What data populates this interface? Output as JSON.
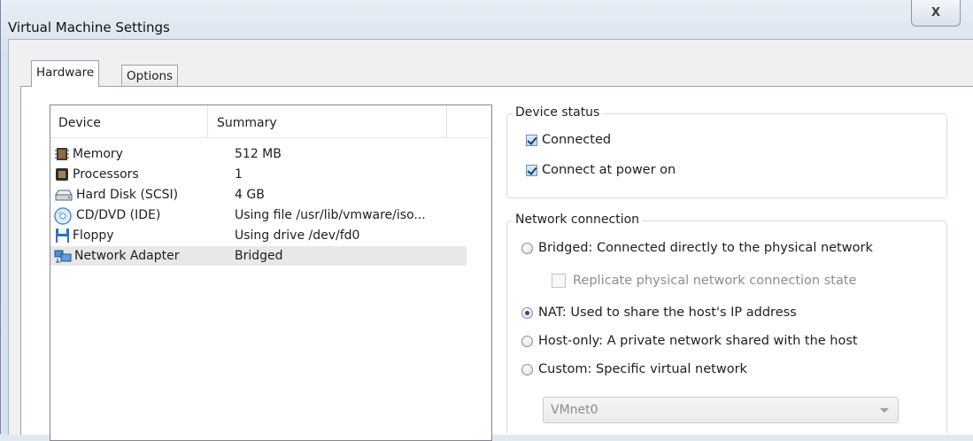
{
  "window": {
    "title": "Virtual Machine Settings",
    "close_glyph": "X"
  },
  "tabs": [
    {
      "label": "Hardware",
      "active": true
    },
    {
      "label": "Options",
      "active": false
    }
  ],
  "device_list": {
    "columns": [
      "Device",
      "Summary"
    ],
    "rows": [
      {
        "icon": "memory-icon",
        "device": "Memory",
        "summary": "512 MB"
      },
      {
        "icon": "processor-icon",
        "device": "Processors",
        "summary": "1"
      },
      {
        "icon": "hard-disk-icon",
        "device": "Hard Disk (SCSI)",
        "summary": "4 GB"
      },
      {
        "icon": "cd-dvd-icon",
        "device": "CD/DVD (IDE)",
        "summary": "Using file /usr/lib/vmware/iso..."
      },
      {
        "icon": "floppy-icon",
        "device": "Floppy",
        "summary": "Using drive /dev/fd0"
      },
      {
        "icon": "network-adapter-icon",
        "device": "Network Adapter",
        "summary": "Bridged"
      }
    ],
    "selected_index": 5
  },
  "device_status": {
    "legend": "Device status",
    "connected_label": "Connected",
    "connected_checked": true,
    "connect_power_label": "Connect at power on",
    "connect_power_checked": true
  },
  "network_connection": {
    "legend": "Network connection",
    "bridged_label": "Bridged: Connected directly to the physical network",
    "replicate_label": "Replicate physical network connection state",
    "nat_label": "NAT: Used to share the host's IP address",
    "host_only_label": "Host-only: A private network shared with the host",
    "custom_label": "Custom: Specific virtual network",
    "selected": "nat",
    "custom_network_value": "VMnet0"
  },
  "colors": {
    "selection": "#e8e8e8",
    "radio_dot": "#2a4f8a",
    "check_mark": "#1d3c6e"
  }
}
